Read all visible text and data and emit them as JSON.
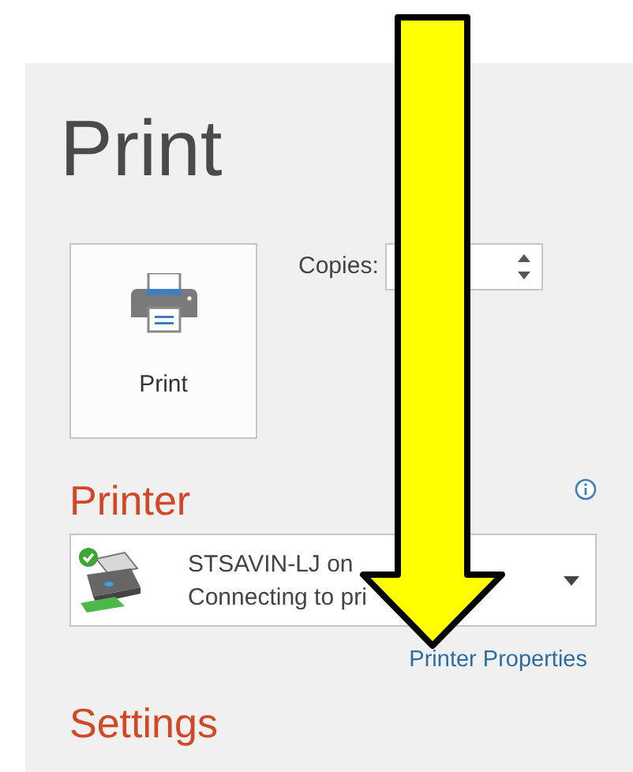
{
  "title": "Print",
  "print_button": {
    "label": "Print"
  },
  "copies": {
    "label": "Copies:"
  },
  "printer": {
    "heading": "Printer",
    "name": "STSAVIN-LJ on",
    "status": "Connecting to pri",
    "status_ok": true,
    "properties_link": "Printer Properties"
  },
  "settings": {
    "heading": "Settings"
  }
}
